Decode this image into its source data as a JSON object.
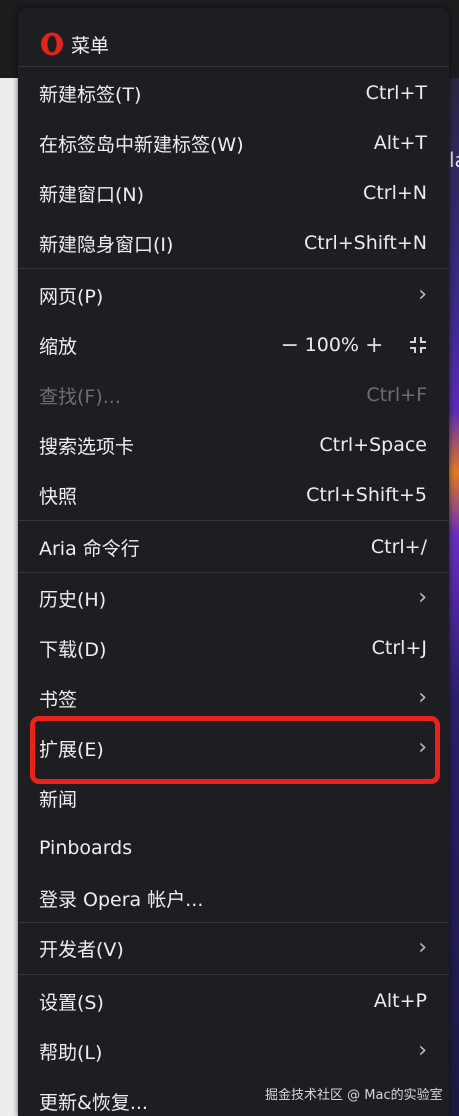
{
  "menu": {
    "title": "菜单",
    "items": [
      {
        "label": "新建标签(T)",
        "shortcut": "Ctrl+T"
      },
      {
        "label": "在标签岛中新建标签(W)",
        "shortcut": "Alt+T"
      },
      {
        "label": "新建窗口(N)",
        "shortcut": "Ctrl+N"
      },
      {
        "label": "新建隐身窗口(I)",
        "shortcut": "Ctrl+Shift+N"
      },
      {
        "label": "网页(P)",
        "submenu_icon": "chevron-right-icon"
      },
      {
        "label": "缩放",
        "zoom_out": "−",
        "zoom_value": "100%",
        "zoom_in": "+",
        "fullscreen_icon": "fullscreen-icon"
      },
      {
        "label": "查找(F)...",
        "shortcut": "Ctrl+F",
        "disabled": true
      },
      {
        "label": "搜索选项卡",
        "shortcut": "Ctrl+Space"
      },
      {
        "label": "快照",
        "shortcut": "Ctrl+Shift+5"
      },
      {
        "label": "Aria 命令行",
        "shortcut": "Ctrl+/"
      },
      {
        "label": "历史(H)",
        "submenu_icon": "chevron-right-icon"
      },
      {
        "label": "下载(D)",
        "shortcut": "Ctrl+J"
      },
      {
        "label": "书签",
        "submenu_icon": "chevron-right-icon"
      },
      {
        "label": "扩展(E)",
        "submenu_icon": "chevron-right-icon",
        "highlighted": true
      },
      {
        "label": "新闻"
      },
      {
        "label": "Pinboards"
      },
      {
        "label": "登录 Opera 帐户..."
      },
      {
        "label": "开发者(V)",
        "submenu_icon": "chevron-right-icon"
      },
      {
        "label": "设置(S)",
        "shortcut": "Alt+P"
      },
      {
        "label": "帮助(L)",
        "submenu_icon": "chevron-right-icon"
      },
      {
        "label": "更新&恢复..."
      }
    ],
    "chevron": "›"
  },
  "background": {
    "strip_text": "la"
  },
  "watermark": "掘金技术社区 @ Mac的实验室",
  "colors": {
    "menu_bg": "#1d1e22",
    "highlight_border": "#e8231c",
    "opera_red": "#e0231c",
    "disabled_text": "#6c6e74"
  }
}
